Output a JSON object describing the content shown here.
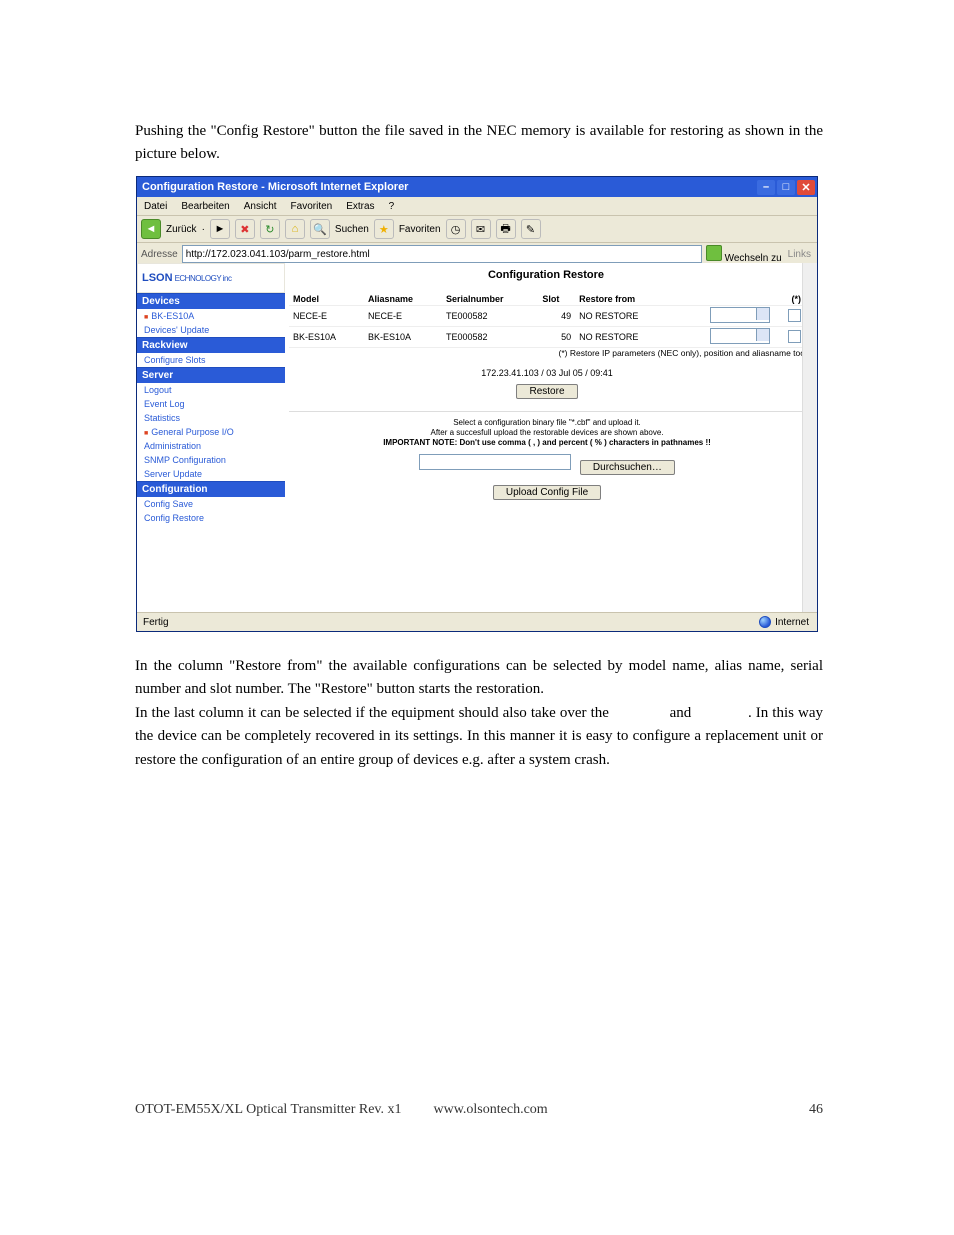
{
  "para1": "Pushing the \"Config Restore\" button the file saved in the NEC memory is available for restoring as shown in the picture below.",
  "para2": "In the column \"Restore from\" the available configurations can be selected by model name, alias name, serial number and slot number. The \"Restore\" button starts the restoration.",
  "para3": "In the last column it can be selected if the equipment should also take over the               and              . In this way the device can be completely recovered in its settings. In this manner it is easy to configure a replacement unit or restore the configuration of an entire group of devices e.g. after a system crash.",
  "footer": {
    "left": "OTOT-EM55X/XL Optical Transmitter Rev. x1",
    "mid": "www.olsontech.com",
    "right": "46"
  },
  "win": {
    "title": "Configuration Restore - Microsoft Internet Explorer",
    "menu": [
      "Datei",
      "Bearbeiten",
      "Ansicht",
      "Favoriten",
      "Extras",
      "?"
    ],
    "toolbar": {
      "back": "Zurück",
      "search": "Suchen",
      "fav": "Favoriten"
    },
    "addr_label": "Adresse",
    "addr_url": "http://172.023.041.103/parm_restore.html",
    "go": "Wechseln zu",
    "links": "Links",
    "logo_top": "LSON",
    "logo_bottom": "ECHNOLOGY inc",
    "page_title": "Configuration Restore",
    "side": {
      "devices": "Devices",
      "dev1": "BK-ES10A",
      "devup": "Devices' Update",
      "rackview": "Rackview",
      "cfgslots": "Configure Slots",
      "server": "Server",
      "logout": "Logout",
      "evlog": "Event Log",
      "stats": "Statistics",
      "gpio": "General Purpose I/O",
      "admin": "Administration",
      "snmp": "SNMP Configuration",
      "svup": "Server Update",
      "config": "Configuration",
      "csave": "Config Save",
      "crestore": "Config Restore"
    },
    "cols": {
      "model": "Model",
      "alias": "Aliasname",
      "serial": "Serialnumber",
      "slot": "Slot",
      "restore": "Restore from",
      "star": "(*)"
    },
    "rows": [
      {
        "model": "NECE-E",
        "alias": "NECE-E",
        "serial": "TE000582",
        "slot": "49",
        "restore": "NO RESTORE"
      },
      {
        "model": "BK-ES10A",
        "alias": "BK-ES10A",
        "serial": "TE000582",
        "slot": "50",
        "restore": "NO RESTORE"
      }
    ],
    "note_star": "(*) Restore IP parameters (NEC only), position and aliasname too",
    "timestamp": "172.23.41.103 / 03 Jul 05 / 09:41",
    "btn_restore": "Restore",
    "hint1": "Select a configuration binary file \"*.cbf\" and upload it.",
    "hint2": "After a succesfull upload the restorable devices are shown above.",
    "hint3": "IMPORTANT NOTE: Don't use comma ( , ) and percent ( % ) characters in pathnames !!",
    "btn_browse": "Durchsuchen…",
    "btn_upload": "Upload Config File",
    "status": "Fertig",
    "zone": "Internet"
  }
}
